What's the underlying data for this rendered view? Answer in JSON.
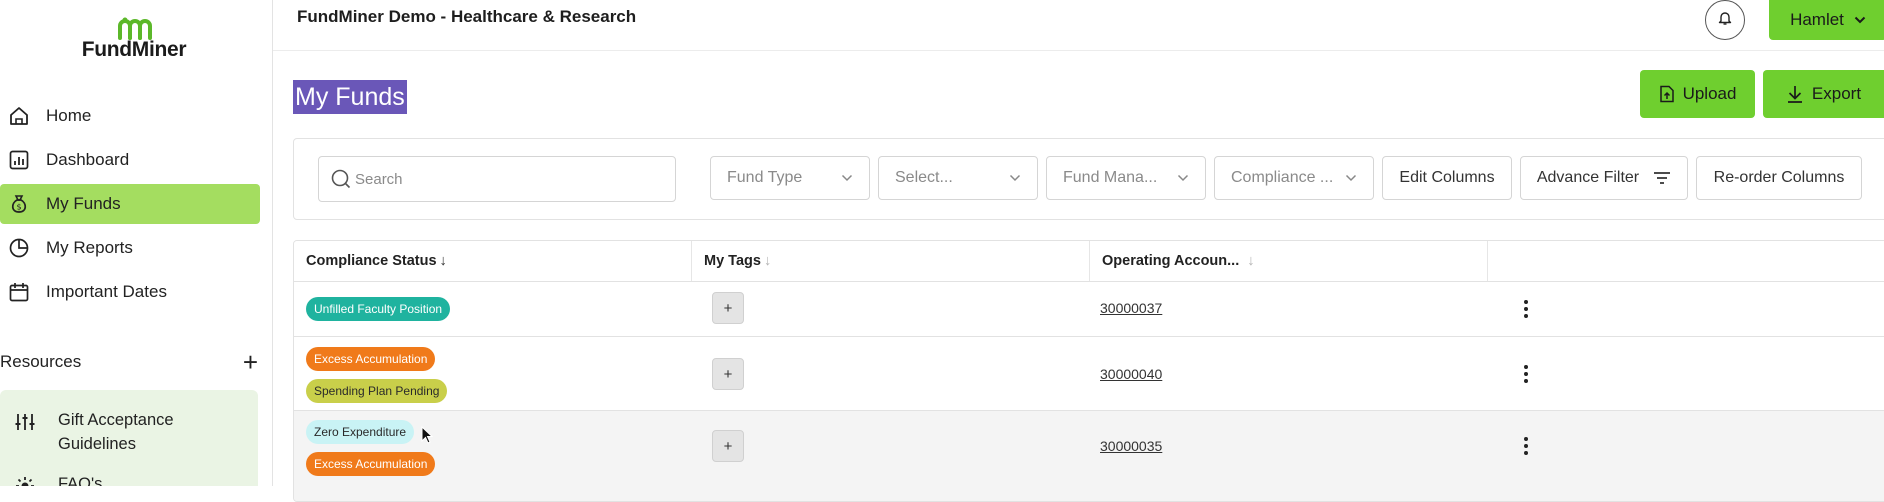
{
  "app": {
    "logo_text": "FundMiner",
    "org_title": "FundMiner Demo - Healthcare & Research"
  },
  "nav": [
    {
      "label": "Home",
      "icon": "home-icon"
    },
    {
      "label": "Dashboard",
      "icon": "bar-chart-icon"
    },
    {
      "label": "My Funds",
      "icon": "money-bag-icon",
      "active": true
    },
    {
      "label": "My Reports",
      "icon": "pie-chart-icon"
    },
    {
      "label": "Important Dates",
      "icon": "calendar-icon"
    }
  ],
  "resources": {
    "label": "Resources",
    "items": [
      {
        "label": "Gift Acceptance Guidelines",
        "icon": "sliders-icon"
      },
      {
        "label": "FAQ's",
        "icon": "sun-icon"
      }
    ]
  },
  "user": {
    "name": "Hamlet"
  },
  "page": {
    "title": "My Funds",
    "upload_label": "Upload",
    "export_label": "Export"
  },
  "filters": {
    "search_placeholder": "Search",
    "fund_type": "Fund Type",
    "select": "Select...",
    "fund_manager": "Fund Mana...",
    "compliance": "Compliance ...",
    "edit_columns": "Edit Columns",
    "advance_filter": "Advance Filter",
    "reorder_columns": "Re-order Columns"
  },
  "table": {
    "columns": [
      "Compliance Status",
      "My Tags",
      "Operating Accoun..."
    ],
    "add_tag_label": "+",
    "rows": [
      {
        "tags": [
          {
            "label": "Unfilled Faculty Position",
            "color": "#1fb39f"
          }
        ],
        "account": "30000037"
      },
      {
        "tags": [
          {
            "label": "Excess Accumulation",
            "color": "#f07a1a"
          },
          {
            "label": "Spending Plan Pending",
            "color": "#c9cf4a"
          }
        ],
        "account": "30000040"
      },
      {
        "tags": [
          {
            "label": "Zero Expenditure",
            "color": "#c9f3f5"
          },
          {
            "label": "Excess Accumulation",
            "color": "#f07a1a"
          }
        ],
        "account": "30000035"
      }
    ]
  },
  "colors": {
    "accent": "#6fcf2f",
    "active_nav": "#a4dd60",
    "title_highlight": "#6a57b8"
  }
}
